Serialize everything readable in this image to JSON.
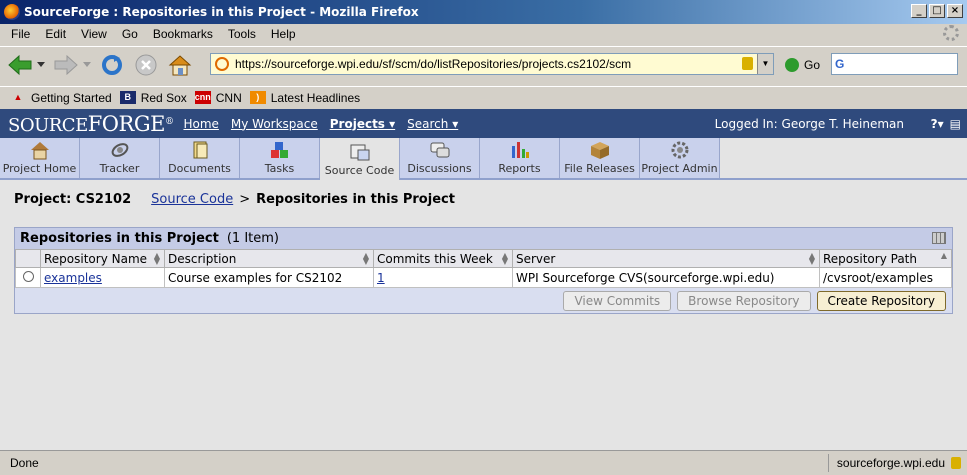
{
  "window": {
    "title": "SourceForge : Repositories in this Project - Mozilla Firefox"
  },
  "menu": [
    "File",
    "Edit",
    "View",
    "Go",
    "Bookmarks",
    "Tools",
    "Help"
  ],
  "navbar": {
    "url": "https://sourceforge.wpi.edu/sf/scm/do/listRepositories/projects.cs2102/scm",
    "go_label": "Go",
    "search_value": "G"
  },
  "bookmarks": [
    "Getting Started",
    "Red Sox",
    "CNN",
    "Latest Headlines"
  ],
  "sf": {
    "logo_prefix": "SOURCE",
    "logo_suffix": "FORGE",
    "top_links": [
      "Home",
      "My Workspace",
      "Projects",
      "Search"
    ],
    "logged_in": "Logged In: George T. Heineman"
  },
  "tabs": [
    {
      "label": "Project Home",
      "icon": "house-icon"
    },
    {
      "label": "Tracker",
      "icon": "satellite-icon"
    },
    {
      "label": "Documents",
      "icon": "documents-icon"
    },
    {
      "label": "Tasks",
      "icon": "blocks-icon"
    },
    {
      "label": "Source Code",
      "icon": "source-code-icon",
      "active": true
    },
    {
      "label": "Discussions",
      "icon": "speech-bubbles-icon"
    },
    {
      "label": "Reports",
      "icon": "bar-chart-icon"
    },
    {
      "label": "File Releases",
      "icon": "box-icon"
    },
    {
      "label": "Project Admin",
      "icon": "gear-icon"
    }
  ],
  "breadcrumb": {
    "project": "Project: CS2102",
    "link": "Source Code",
    "sep": ">",
    "current": "Repositories in this Project"
  },
  "panel": {
    "title": "Repositories in this Project",
    "count": "(1 Item)",
    "columns": [
      "Repository Name",
      "Description",
      "Commits this Week",
      "Server",
      "Repository Path"
    ],
    "rows": [
      {
        "name": "examples",
        "description": "Course examples for CS2102",
        "commits": "1",
        "server": "WPI Sourceforge CVS(sourceforge.wpi.edu)",
        "path": "/cvsroot/examples"
      }
    ],
    "buttons": {
      "view_commits": "View Commits",
      "browse": "Browse Repository",
      "create": "Create Repository"
    }
  },
  "status": {
    "text": "Done",
    "host": "sourceforge.wpi.edu"
  },
  "colors": {
    "header": "#2f4a7d",
    "tab_bg": "#c9d1ec",
    "link": "#1a3399"
  }
}
